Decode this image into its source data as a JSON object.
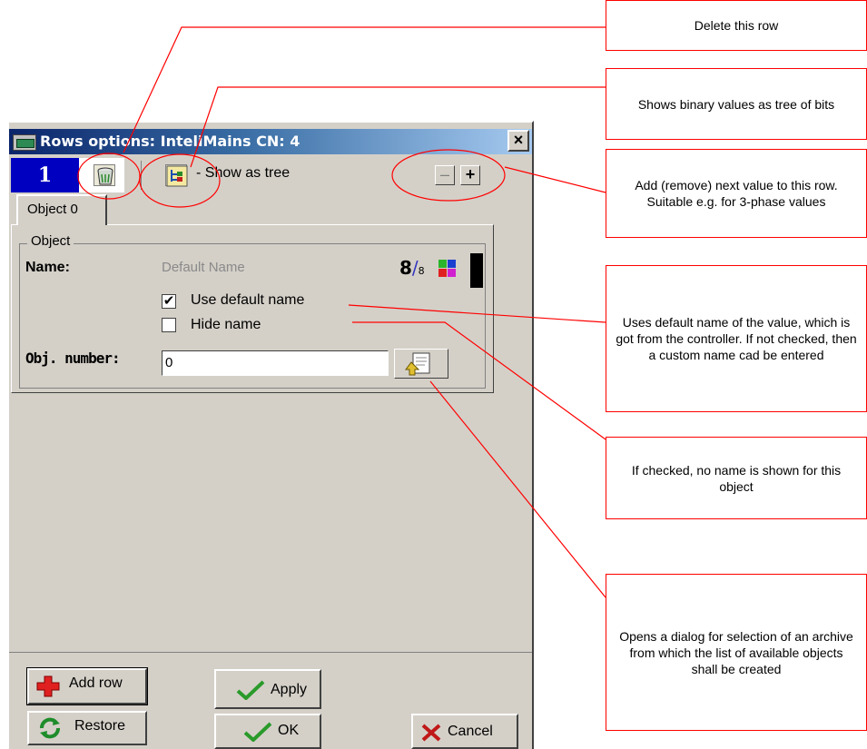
{
  "window": {
    "title": "Rows options: InteliMains CN: 4",
    "close_label": "×"
  },
  "row_toolbar": {
    "row_number": "1",
    "show_as_tree_label": "- Show as tree",
    "minus_label": "–",
    "plus_label": "+"
  },
  "tab": {
    "label": "Object 0"
  },
  "object_group": {
    "legend": "Object",
    "name_label": "Name:",
    "name_value": "Default Name",
    "bits_digit": "8",
    "bits_slash": "/",
    "bits_sub": "8",
    "use_default_name_label": "Use default name",
    "use_default_name_checked": "✔",
    "hide_name_label": "Hide name",
    "obj_number_label": "Obj. number:",
    "obj_number_value": "0"
  },
  "buttons": {
    "add_row": "Add row",
    "restore": "Restore",
    "apply": "Apply",
    "ok": "OK",
    "cancel": "Cancel"
  },
  "annotations": {
    "delete_row": "Delete this row",
    "binary_tree": "Shows binary values as tree of bits",
    "add_remove": "Add (remove) next value to this row. Suitable e.g. for 3-phase values",
    "use_default_name": "Uses default name of the value, which is got from the controller. If not checked, then a custom name cad be entered",
    "hide_name": "If checked, no name is shown for this object",
    "archive_dialog": "Opens a dialog for selection of an archive from which the list of available objects shall be created"
  },
  "colors": {
    "annotation_red": "#ff0000",
    "dialog_face": "#d4d0c8",
    "row_number_bg": "#0000c0",
    "titlebar_start": "#0a246a",
    "titlebar_end": "#a6caf0"
  }
}
